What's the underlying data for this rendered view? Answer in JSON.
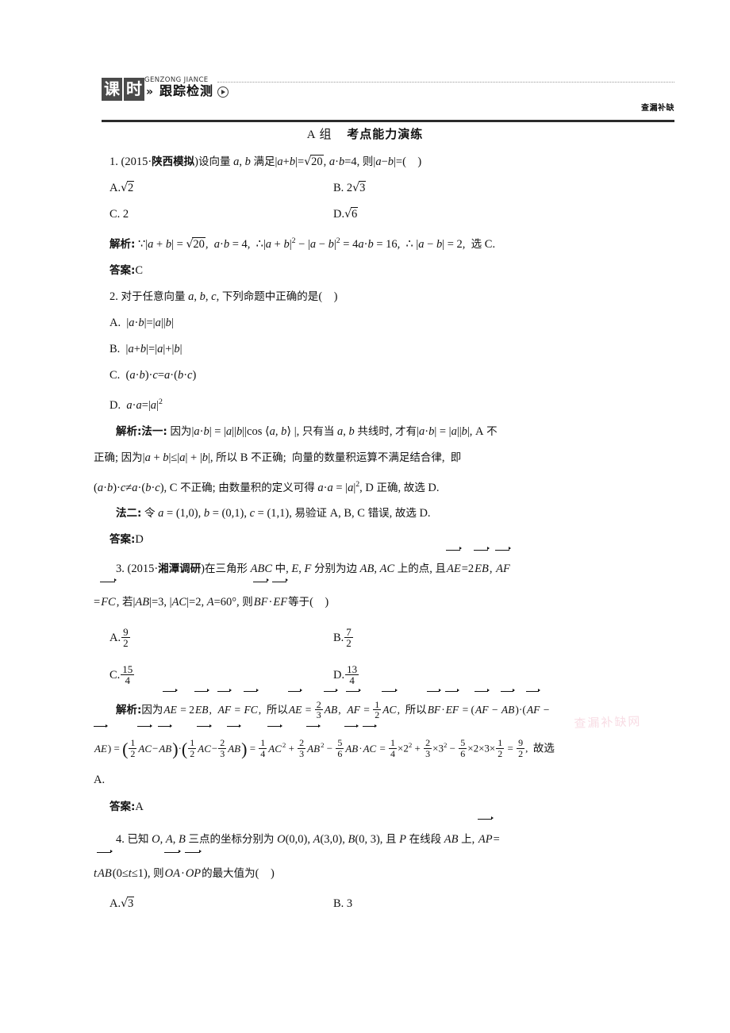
{
  "header": {
    "badge_char1": "课",
    "badge_char2": "时",
    "chevron": "»",
    "pinyin": "GENZONG JIANCE",
    "title_cn": "跟踪检测",
    "right_label": "查漏补缺"
  },
  "section": {
    "group": "A 组",
    "title": "考点能力演练"
  },
  "questions": [
    {
      "number": "1.",
      "stem_prefix": "1.(2015·陕西模拟)设向量 a, b 满足|a+b|=",
      "stem_sqrt": "20",
      "stem_suffix": ", a·b=4, 则|a−b|=(    )",
      "options": [
        {
          "key": "A.",
          "text": "√2"
        },
        {
          "key": "B.",
          "text": "2√3"
        },
        {
          "key": "C.",
          "text": "2"
        },
        {
          "key": "D.",
          "text": "√6"
        }
      ],
      "analysis_label": "解析:",
      "analysis": "∵|a+b| = √20, a·b = 4, ∴|a+b|² − |a−b|² = 4a·b = 16, ∴|a−b| = 2, 选 C.",
      "answer_label": "答案:",
      "answer": "C"
    },
    {
      "number": "2.",
      "stem": "2.对于任意向量 a, b, c, 下列命题中正确的是(    )",
      "options": [
        {
          "key": "A.",
          "text": "|a·b|=|a||b|"
        },
        {
          "key": "B.",
          "text": "|a+b|=|a|+|b|"
        },
        {
          "key": "C.",
          "text": "(a·b)·c=a·(b·c)"
        },
        {
          "key": "D.",
          "text": "a·a=|a|²"
        }
      ],
      "analysis_label": "解析:",
      "analysis_method1_label": "法一:",
      "analysis_l1": "因为|a·b| = |a||b||cos ⟨a, b⟩ |, 只有当 a, b 共线时, 才有|a·b| = |a||b|, A 不",
      "analysis_l2": "正确; 因为|a + b|≤|a| + |b|, 所以 B 不正确; 向量的数量积运算不满足结合律, 即",
      "analysis_l3": "(a·b)·c≠a·(b·c), C 不正确; 由数量积的定义可得 a·a = |a|², D 正确, 故选 D.",
      "analysis_method2_label": "法二:",
      "analysis_l4": "令 a = (1,0), b = (0,1), c = (1,1), 易验证 A, B, C 错误, 故选 D.",
      "answer_label": "答案:",
      "answer": "D"
    },
    {
      "number": "3.",
      "stem_l1": "3.(2015·湘潭调研)在三角形 ABC 中, E, F 分别为边 AB, AC 上的点, 且AE=2EB, AF",
      "stem_l2": "=FC, 若|AB|=3, |AC|=2, A=60°, 则BF·EF等于(    )",
      "options": [
        {
          "key": "A.",
          "num": "9",
          "den": "2"
        },
        {
          "key": "B.",
          "num": "7",
          "den": "2"
        },
        {
          "key": "C.",
          "num": "15",
          "den": "4"
        },
        {
          "key": "D.",
          "num": "13",
          "den": "4"
        }
      ],
      "analysis_label": "解析:",
      "analysis_l1": "因为AE = 2EB, AF = FC, 所以AE = (2/3)AB, AF = (1/2)AC, 所以BF·EF = (AF − AB)·(AF −",
      "analysis_l2": "AE) = ((1/2)AC − AB)·((1/2)AC − (2/3)AB) = (1/4)AC² + (2/3)AB² − (5/6)AB·AC = (1/4)×2² + (2/3)×3² − (5/6)×2×3×(1/2) = 9/2, 故选",
      "analysis_l3": "A.",
      "answer_label": "答案:",
      "answer": "A"
    },
    {
      "number": "4.",
      "stem_l1": "4.已知 O, A, B 三点的坐标分别为 O(0,0), A(3,0), B(0, 3), 且 P 在线段 AB 上, AP=",
      "stem_l2": "tAB(0≤t≤1), 则OA·OP的最大值为(    )",
      "options": [
        {
          "key": "A.",
          "text": "√3"
        },
        {
          "key": "B.",
          "text": "3"
        }
      ]
    }
  ],
  "watermark": "查漏补缺网"
}
